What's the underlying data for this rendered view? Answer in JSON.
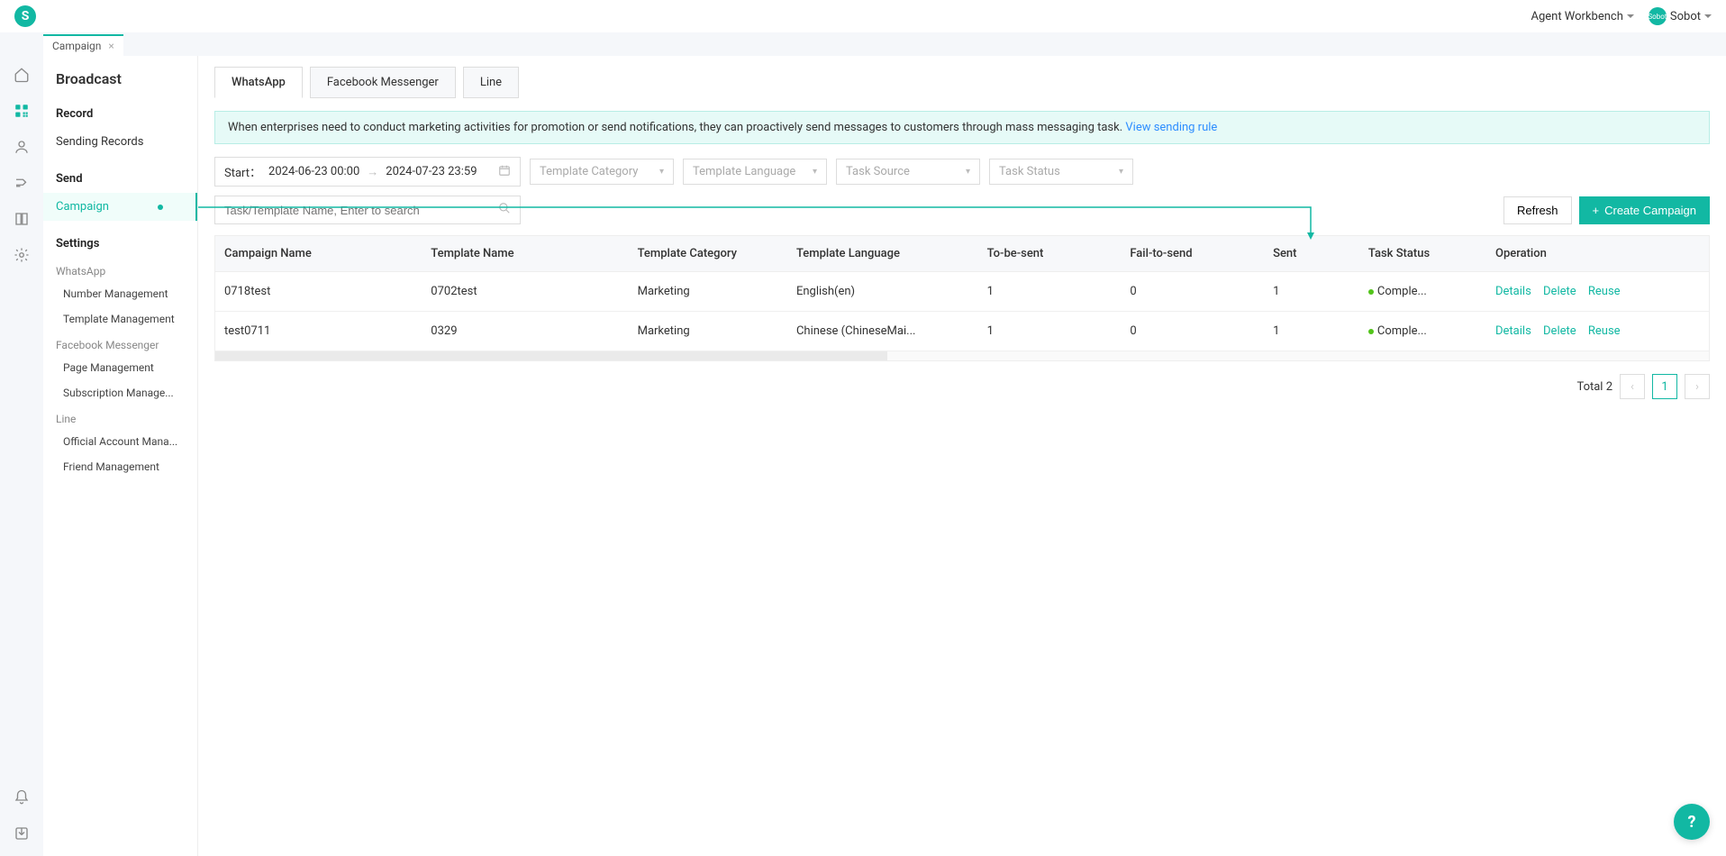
{
  "header": {
    "logo_letter": "S",
    "workbench": "Agent Workbench",
    "avatar_text": "Sobot",
    "username": "Sobot"
  },
  "tab": {
    "title": "Campaign"
  },
  "sidebar": {
    "title": "Broadcast",
    "record_title": "Record",
    "record_items": [
      "Sending Records"
    ],
    "send_title": "Send",
    "send_items": [
      "Campaign"
    ],
    "settings_title": "Settings",
    "whatsapp_group": "WhatsApp",
    "whatsapp_items": [
      "Number Management",
      "Template Management"
    ],
    "fb_group": "Facebook Messenger",
    "fb_items": [
      "Page Management",
      "Subscription Manage..."
    ],
    "line_group": "Line",
    "line_items": [
      "Official Account Mana...",
      "Friend Management"
    ]
  },
  "channel_tabs": [
    "WhatsApp",
    "Facebook Messenger",
    "Line"
  ],
  "banner": {
    "text": "When enterprises need to conduct marketing activities for promotion or send notifications, they can proactively send messages to customers through mass messaging task. ",
    "link": "View sending rule"
  },
  "filters": {
    "start_label": "Start：",
    "start_value": "2024-06-23 00:00",
    "end_value": "2024-07-23 23:59",
    "template_category_ph": "Template Category",
    "template_language_ph": "Template Language",
    "task_source_ph": "Task Source",
    "task_status_ph": "Task Status",
    "search_ph": "Task/Template Name, Enter to search"
  },
  "buttons": {
    "refresh": "Refresh",
    "create": "Create Campaign"
  },
  "table": {
    "headers": [
      "Campaign Name",
      "Template Name",
      "Template Category",
      "Template Language",
      "To-be-sent",
      "Fail-to-send",
      "Sent",
      "Task Status",
      "Operation"
    ],
    "rows": [
      {
        "campaign": "0718test",
        "template": "0702test",
        "category": "Marketing",
        "language": "English(en)",
        "tobesent": "1",
        "fail": "0",
        "sent": "1",
        "status": "Comple..."
      },
      {
        "campaign": "test0711",
        "template": "0329",
        "category": "Marketing",
        "language": "Chinese (ChineseMai...",
        "tobesent": "1",
        "fail": "0",
        "sent": "1",
        "status": "Comple..."
      }
    ],
    "actions": {
      "details": "Details",
      "delete": "Delete",
      "reuse": "Reuse"
    }
  },
  "pagination": {
    "total_label": "Total 2",
    "current": "1"
  }
}
